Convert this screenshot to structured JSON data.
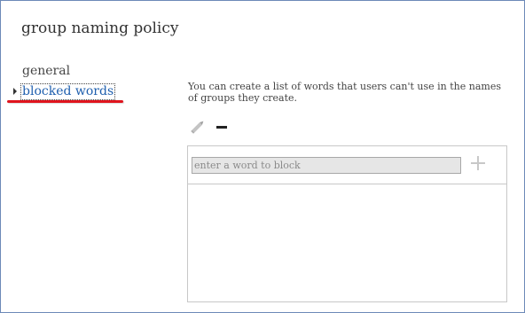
{
  "page": {
    "title": "group naming policy"
  },
  "nav": {
    "items": [
      {
        "label": "general"
      },
      {
        "label": "blocked words"
      }
    ]
  },
  "blocked_words": {
    "description": "You can create a list of words that users can't use in the names of groups they create.",
    "input_placeholder": "enter a word to block",
    "input_value": "",
    "words": []
  },
  "icons": {
    "edit": "pencil-icon",
    "remove": "minus-icon",
    "add": "plus-icon",
    "selected_marker": "triangle-right-icon"
  },
  "colors": {
    "link": "#1f5fae",
    "annotation": "#e0141e",
    "frame_border": "#6d8ab8"
  }
}
